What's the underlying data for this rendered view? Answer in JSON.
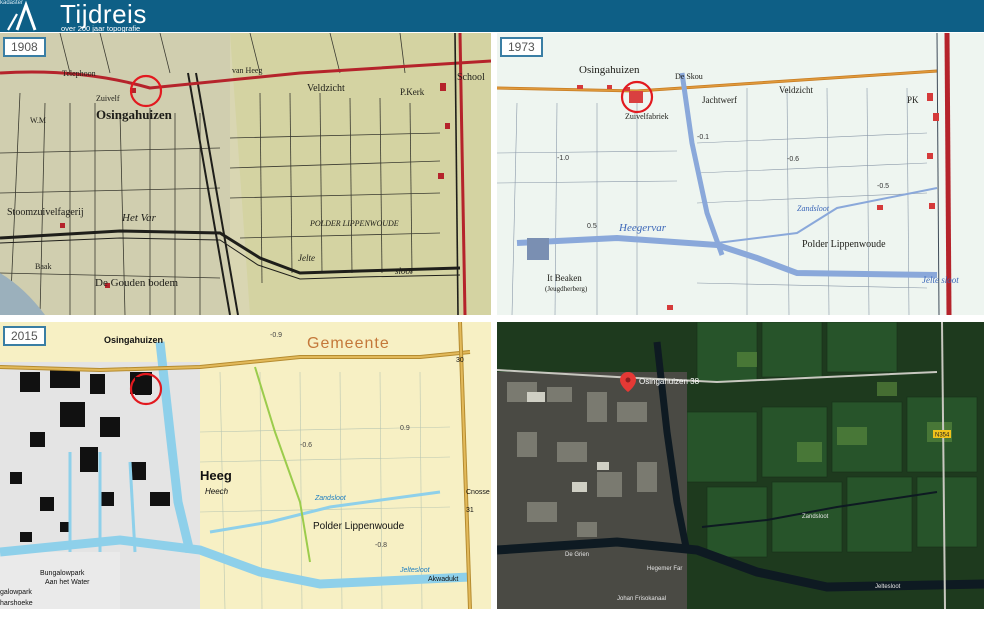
{
  "header": {
    "org": "kadaster",
    "title": "Tijdreis",
    "subtitle": "over 200 jaar topografie",
    "bar_color": "#0e5f86"
  },
  "panels": [
    {
      "year": "1908",
      "labels": {
        "veldzicht": "Veldzicht",
        "school": "School",
        "pkerk": "P.Kerk",
        "osingahuizen": "Osingahuizen",
        "zuivelf": "Zuivelf",
        "stoomzuivel": "Stoomzuivelfagerij",
        "hetvar": "Het Var",
        "polder": "POLDER  LIPPENWOUDE",
        "jelte": "Jelte",
        "sloot": "sloot",
        "goudenbodem": "De Gouden bodem",
        "baak": "Baak",
        "telephoon": "Telephoon",
        "vanheeg": "van Heeg",
        "wm": "W.M"
      }
    },
    {
      "year": "1973",
      "labels": {
        "osingahuizen": "Osingahuizen",
        "deskou": "De Skou",
        "veldzicht": "Veldzicht",
        "jachtwerf": "Jachtwerf",
        "zuivelfabriek": "Zuivelfabriek",
        "heegervar": "Heegervar",
        "polder": "Polder  Lippenwoude",
        "zandsloot": "Zandsloot",
        "jeltesloot": "Jelte sloot",
        "beaken": "It Beaken",
        "jeugdherberg": "(Jeugdherberg)",
        "pk": "PK",
        "v1": "-0.1",
        "v2": "-1.0",
        "v3": "-0.6",
        "v4": "-0.5",
        "v5": "0.5"
      }
    },
    {
      "year": "2015",
      "labels": {
        "osingahuizen": "Osingahuizen",
        "gemeente": "Gemeente",
        "heeg": "Heeg",
        "heech": "Heech",
        "polder": "Polder   Lippenwoude",
        "zandsloot": "Zandsloot",
        "jeltesloot": "Jeltesloot",
        "akwadukt": "Akwadukt",
        "bungalowpark": "Bungalowpark",
        "aanhetwater": "Aan het Water",
        "galowpark": "galowpark",
        "harshoeke": "harshoeke",
        "cnosse": "Cnosse",
        "v1": "-0.9",
        "v2": "-0.8",
        "v3": "-0.6",
        "v4": "0.9",
        "n31": "31",
        "n30": "30"
      }
    },
    {
      "labels": {
        "pin": "Osingahuizen 38",
        "zandsloot": "Zandsloot",
        "hegemerfar": "Hegemer Far",
        "jeltesloot": "Jeltesloot",
        "road": "N354",
        "degrien": "De Grien",
        "johanfriso": "Johan Frisokanaal"
      }
    }
  ]
}
